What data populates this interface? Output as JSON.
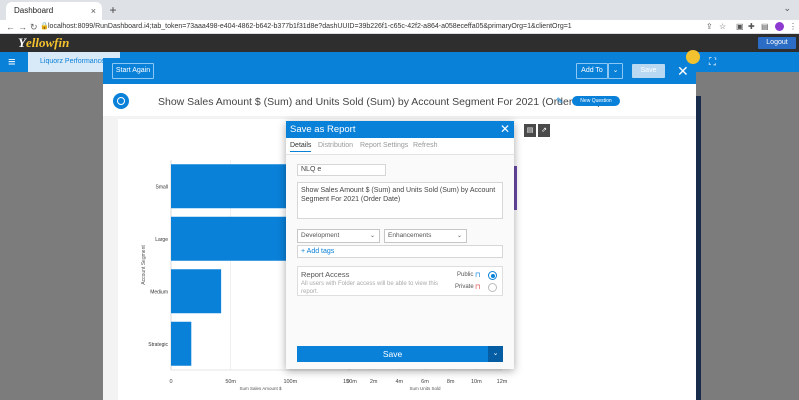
{
  "browser": {
    "tab_title": "Dashboard",
    "tab_close": "×",
    "new_tab": "+",
    "url": "localhost:8099/RunDashboard.i4;tab_token=73aaa498-e404-4862-b642-b377b1f31d8e?dashUUID=39b226f1-c65c-42f2-a864-a058eceffa05&primaryOrg=1&clientOrg=1",
    "profile_initial": "I"
  },
  "app": {
    "logo_prefix": "ellow",
    "logo_suffix": "fin",
    "logo_y": "Y",
    "logout_label": "Logout",
    "nav_title": "Liquorz Performance"
  },
  "report_toolbar": {
    "start_again": "Start Again",
    "add_to": "Add To",
    "save": "Save"
  },
  "report": {
    "title": "Show Sales Amount $ (Sum) and Units Sold (Sum) by Account Segment For 2021 (Order Date)",
    "new_question": "New Question"
  },
  "modal": {
    "title": "Save as Report",
    "tabs": [
      "Details",
      "Distribution",
      "Report Settings",
      "Refresh"
    ],
    "name_value": "NLQ e",
    "description_value": "Show Sales Amount $ (Sum) and Units Sold (Sum) by Account Segment For 2021 (Order Date)",
    "folder_select": "Development",
    "subfolder_select": "Enhancements",
    "add_tags": "+ Add tags",
    "access_title": "Report Access",
    "access_desc": "All users with Folder access will be able to view this report.",
    "public_label": "Public",
    "private_label": "Private",
    "save_label": "Save"
  },
  "chart_data": {
    "type": "bar",
    "orientation": "horizontal",
    "ylabel": "Account Segment",
    "categories": [
      "Small",
      "Large",
      "Medium",
      "Strategic"
    ],
    "series": [
      {
        "name": "Sum Sales Amount $",
        "values": [
          148,
          148,
          42,
          17
        ],
        "xlim": [
          0,
          150
        ],
        "ticks": [
          "0",
          "50m",
          "100m",
          "150m"
        ],
        "xlabel": "Sum Sales Amount $"
      },
      {
        "name": "Sum Units Sold",
        "values": [
          0.4,
          0,
          0,
          0
        ],
        "xlim": [
          0,
          12
        ],
        "ticks": [
          "0",
          "2m",
          "4m",
          "6m",
          "8m",
          "10m",
          "12m"
        ],
        "xlabel": "Sum Units Sold"
      }
    ],
    "colors": {
      "bar": "#0a81d9"
    }
  }
}
